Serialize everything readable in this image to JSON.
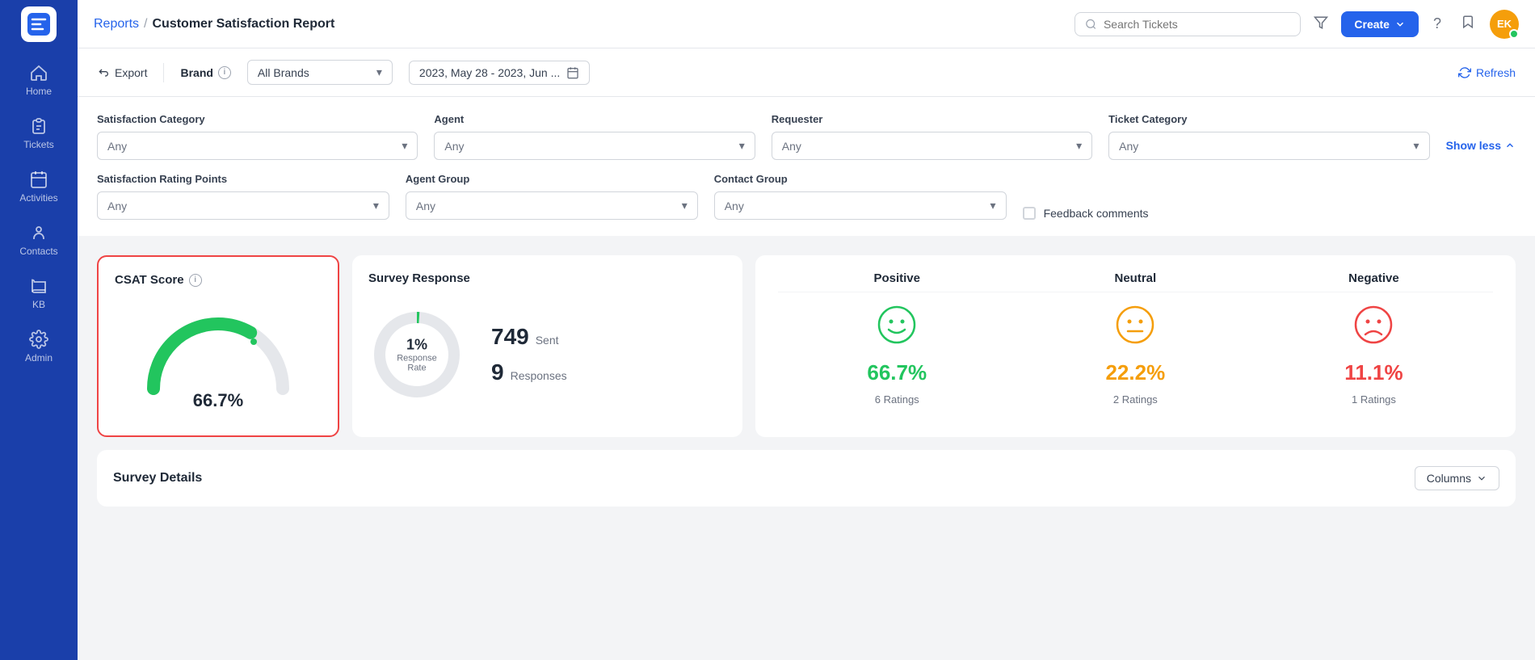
{
  "sidebar": {
    "logo_alt": "Brand Logo",
    "items": [
      {
        "id": "home",
        "label": "Home",
        "icon": "home-icon",
        "active": false
      },
      {
        "id": "tickets",
        "label": "Tickets",
        "icon": "tickets-icon",
        "active": false
      },
      {
        "id": "activities",
        "label": "Activities",
        "icon": "activities-icon",
        "active": false
      },
      {
        "id": "contacts",
        "label": "Contacts",
        "icon": "contacts-icon",
        "active": false
      },
      {
        "id": "kb",
        "label": "KB",
        "icon": "kb-icon",
        "active": false
      },
      {
        "id": "admin",
        "label": "Admin",
        "icon": "admin-icon",
        "active": false
      }
    ]
  },
  "topnav": {
    "breadcrumb": {
      "reports": "Reports",
      "separator": "/",
      "current": "Customer Satisfaction Report"
    },
    "search_placeholder": "Search Tickets",
    "create_label": "Create",
    "avatar_initials": "EK"
  },
  "toolbar": {
    "export_label": "Export",
    "brand_label": "Brand",
    "brand_select_value": "All Brands",
    "date_range": "2023, May 28 - 2023, Jun ...",
    "refresh_label": "Refresh"
  },
  "filters": {
    "show_less_label": "Show less",
    "row1": {
      "satisfaction_category": {
        "label": "Satisfaction Category",
        "value": "Any"
      },
      "agent": {
        "label": "Agent",
        "value": "Any"
      },
      "requester": {
        "label": "Requester",
        "value": "Any"
      },
      "ticket_category": {
        "label": "Ticket Category",
        "value": "Any"
      }
    },
    "row2": {
      "satisfaction_rating": {
        "label": "Satisfaction Rating Points",
        "value": "Any"
      },
      "agent_group": {
        "label": "Agent Group",
        "value": "Any"
      },
      "contact_group": {
        "label": "Contact Group",
        "value": "Any"
      },
      "feedback_comments_label": "Feedback comments"
    }
  },
  "csat_card": {
    "title": "CSAT Score",
    "value": "66.7%",
    "gauge_percentage": 66.7
  },
  "survey_card": {
    "title": "Survey Response",
    "response_rate_pct": "1%",
    "response_rate_label": "Response Rate",
    "sent_count": "749",
    "sent_label": "Sent",
    "responses_count": "9",
    "responses_label": "Responses"
  },
  "ratings_card": {
    "positive": {
      "label": "Positive",
      "pct": "66.7%",
      "count": "6 Ratings"
    },
    "neutral": {
      "label": "Neutral",
      "pct": "22.2%",
      "count": "2 Ratings"
    },
    "negative": {
      "label": "Negative",
      "pct": "11.1%",
      "count": "1 Ratings"
    }
  },
  "survey_details": {
    "title": "Survey Details",
    "columns_label": "Columns"
  },
  "colors": {
    "primary": "#2563eb",
    "positive": "#22c55e",
    "neutral": "#f59e0b",
    "negative": "#ef4444",
    "gauge_fill": "#22c55e",
    "gauge_bg": "#e5e7eb"
  }
}
